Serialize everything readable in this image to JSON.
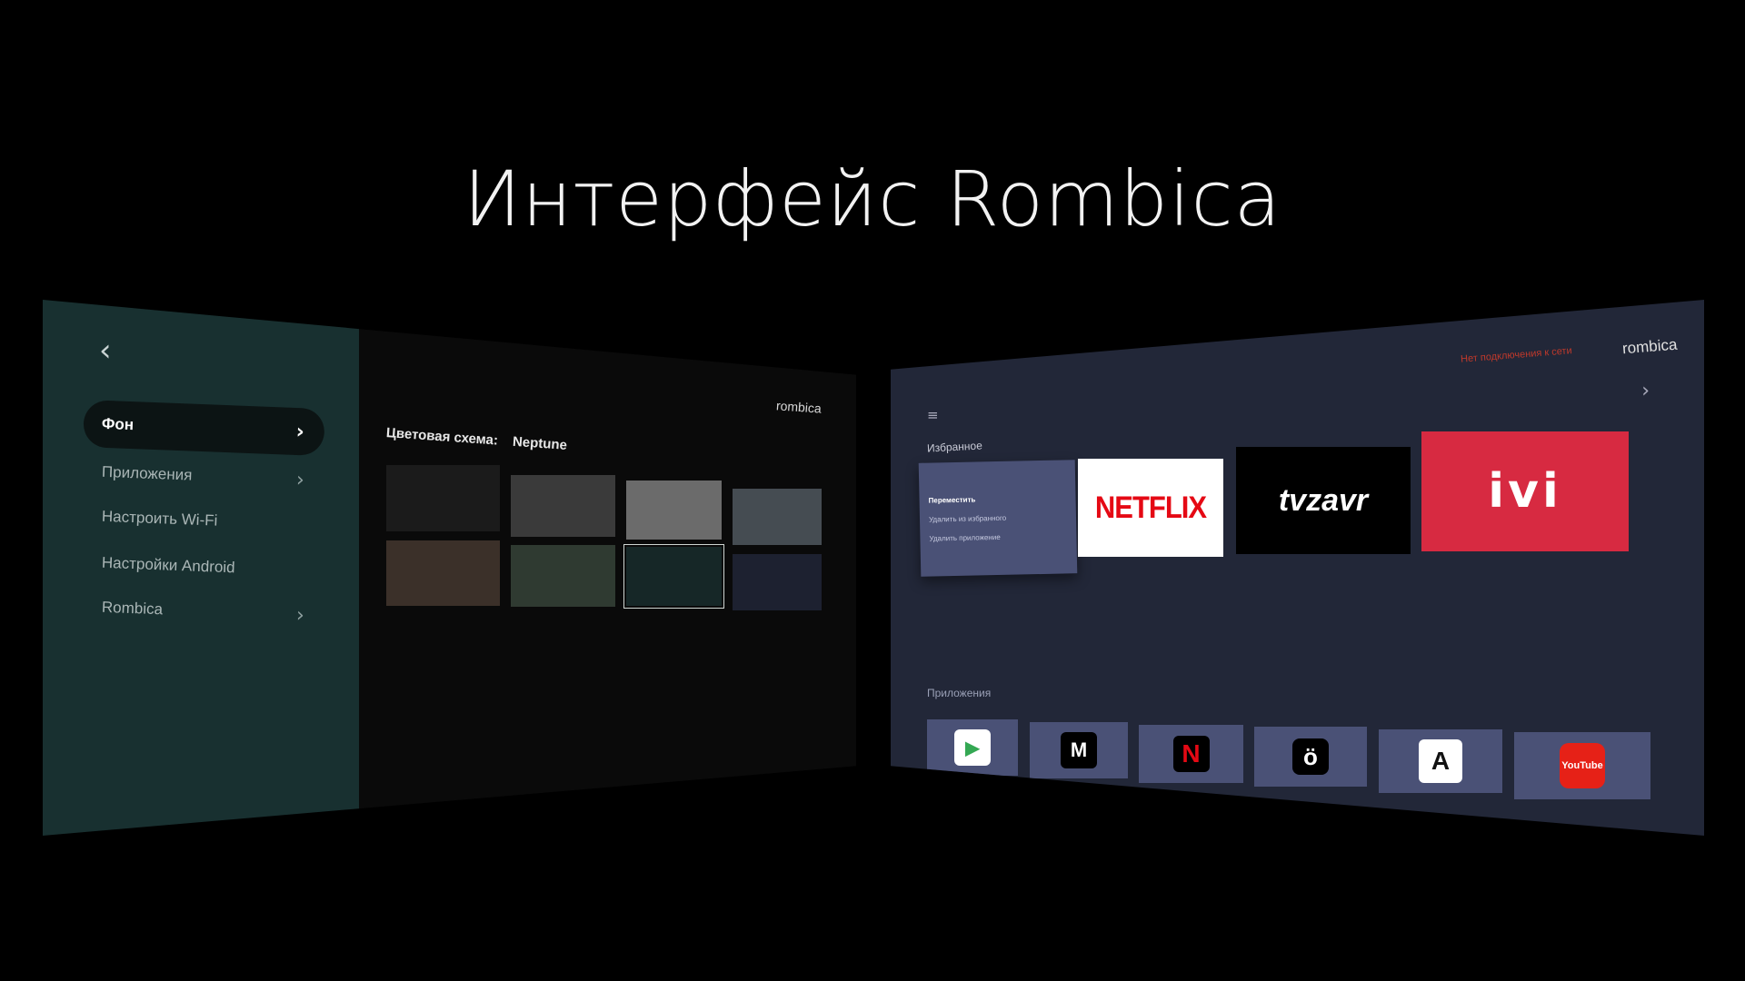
{
  "headline": "Интерфейс Rombica",
  "left_screen": {
    "back_icon": "chevron-left-icon",
    "menu": [
      {
        "label": "Фон",
        "has_chevron": true,
        "active": true
      },
      {
        "label": "Приложения",
        "has_chevron": true,
        "active": false
      },
      {
        "label": "Настроить Wi-Fi",
        "has_chevron": false,
        "active": false
      },
      {
        "label": "Настройки Android",
        "has_chevron": false,
        "active": false
      },
      {
        "label": "Rombica",
        "has_chevron": true,
        "active": false
      }
    ],
    "chevron_glyph": "›",
    "brand": "rombica",
    "scheme_label": "Цветовая схема:",
    "scheme_value": "Neptune",
    "swatches": [
      "#1b1b1b",
      "#3a3a3a",
      "#6b6b6b",
      "#454c52",
      "#3b3029",
      "#2f3a31",
      "#162727",
      "#1d2130"
    ],
    "selected_swatch_index": 6
  },
  "right_screen": {
    "no_network": "Нет подключения к сети",
    "brand": "rombica",
    "favorites_label": "Избранное",
    "context_menu": [
      "Переместить",
      "Удалить из избранного",
      "Удалить приложение"
    ],
    "favorites": [
      {
        "name": "NETFLIX",
        "bg": "#ffffff",
        "color": "#e50914"
      },
      {
        "name": "tvzavr",
        "bg": "#000000",
        "color": "#ffffff"
      },
      {
        "name": "ivi",
        "bg": "#d72a41",
        "color": "#ffffff"
      }
    ],
    "apps_label": "Приложения",
    "apps": [
      {
        "icon": "play-store-icon",
        "glyph": "▶"
      },
      {
        "icon": "megogo-icon",
        "glyph": "M"
      },
      {
        "icon": "netflix-icon",
        "glyph": "N"
      },
      {
        "icon": "okko-icon",
        "glyph": "ö"
      },
      {
        "icon": "amediateka-icon",
        "glyph": "A"
      },
      {
        "icon": "youtube-icon",
        "glyph": "YouTube"
      }
    ],
    "menu_glyph": "≡",
    "chevron_glyph": "›"
  }
}
